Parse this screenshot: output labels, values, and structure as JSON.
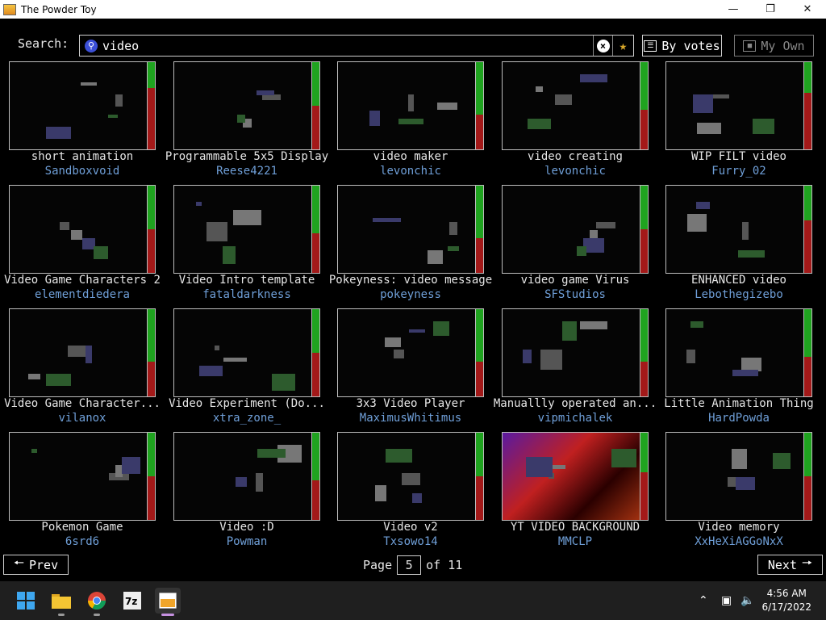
{
  "window": {
    "title": "The Powder Toy"
  },
  "search": {
    "label": "Search:",
    "value": "video"
  },
  "sort_button": {
    "label": "By votes"
  },
  "own_button": {
    "label": "My Own"
  },
  "saves": [
    {
      "name": "short animation",
      "author": "Sandboxvoid",
      "up": 0.3
    },
    {
      "name": "Programmable 5x5 Display",
      "author": "Reese4221",
      "up": 0.5
    },
    {
      "name": "video maker",
      "author": "levonchic",
      "up": 0.6
    },
    {
      "name": "video creating",
      "author": "levonchic",
      "up": 0.55
    },
    {
      "name": "WIP FILT video",
      "author": "Furry_02",
      "up": 0.35
    },
    {
      "name": "Video Game Characters 2",
      "author": "elementdiedera",
      "up": 0.5
    },
    {
      "name": "Video Intro template",
      "author": "fataldarkness",
      "up": 0.55
    },
    {
      "name": "Pokeyness: video message",
      "author": "pokeyness",
      "up": 0.6
    },
    {
      "name": "video game Virus",
      "author": "SFStudios",
      "up": 0.5
    },
    {
      "name": "ENHANCED video",
      "author": "Lebothegizebo",
      "up": 0.4
    },
    {
      "name": "Video Game Character...",
      "author": "vilanox",
      "up": 0.6
    },
    {
      "name": "Video Experiment (Do...",
      "author": "xtra_zone_",
      "up": 0.5
    },
    {
      "name": "3x3 Video Player",
      "author": "MaximusWhitimus",
      "up": 0.6
    },
    {
      "name": "Manuallly operated an...",
      "author": "vipmichalek",
      "up": 0.6
    },
    {
      "name": "Little Animation Thing",
      "author": "HardPowda",
      "up": 0.55
    },
    {
      "name": "Pokemon Game",
      "author": "6srd6",
      "up": 0.5
    },
    {
      "name": "Video :D",
      "author": "Powman",
      "up": 0.55
    },
    {
      "name": "Video v2",
      "author": "Txsowo14",
      "up": 0.5
    },
    {
      "name": "YT VIDEO BACKGROUND",
      "author": "MMCLP",
      "up": 0.45
    },
    {
      "name": "Video memory",
      "author": "XxHeXiAGGoNxX",
      "up": 0.5
    }
  ],
  "pager": {
    "prev": "Prev",
    "next": "Next",
    "page_label": "Page",
    "current": "5",
    "of_label": "of 11"
  },
  "taskbar": {
    "time": "4:56 AM",
    "date": "6/17/2022"
  }
}
